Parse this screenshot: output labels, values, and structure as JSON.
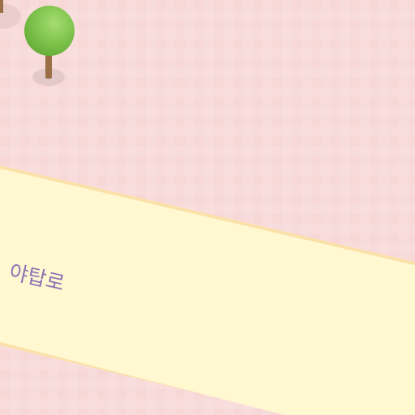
{
  "map": {
    "colors": {
      "land": "#f8dcdc",
      "road_fill": "#fff8d0",
      "road_edge": "#fbe0a8",
      "road_label": "#8a72b4",
      "tree_canopy": "#7cc24a",
      "tree_trunk": "#9b6f45",
      "tree_shadow": "#d8c3c3"
    },
    "roads": [
      {
        "name": "야탑로"
      }
    ],
    "trees": [
      {
        "icon": "tree-icon"
      },
      {
        "icon": "tree-icon"
      }
    ]
  }
}
